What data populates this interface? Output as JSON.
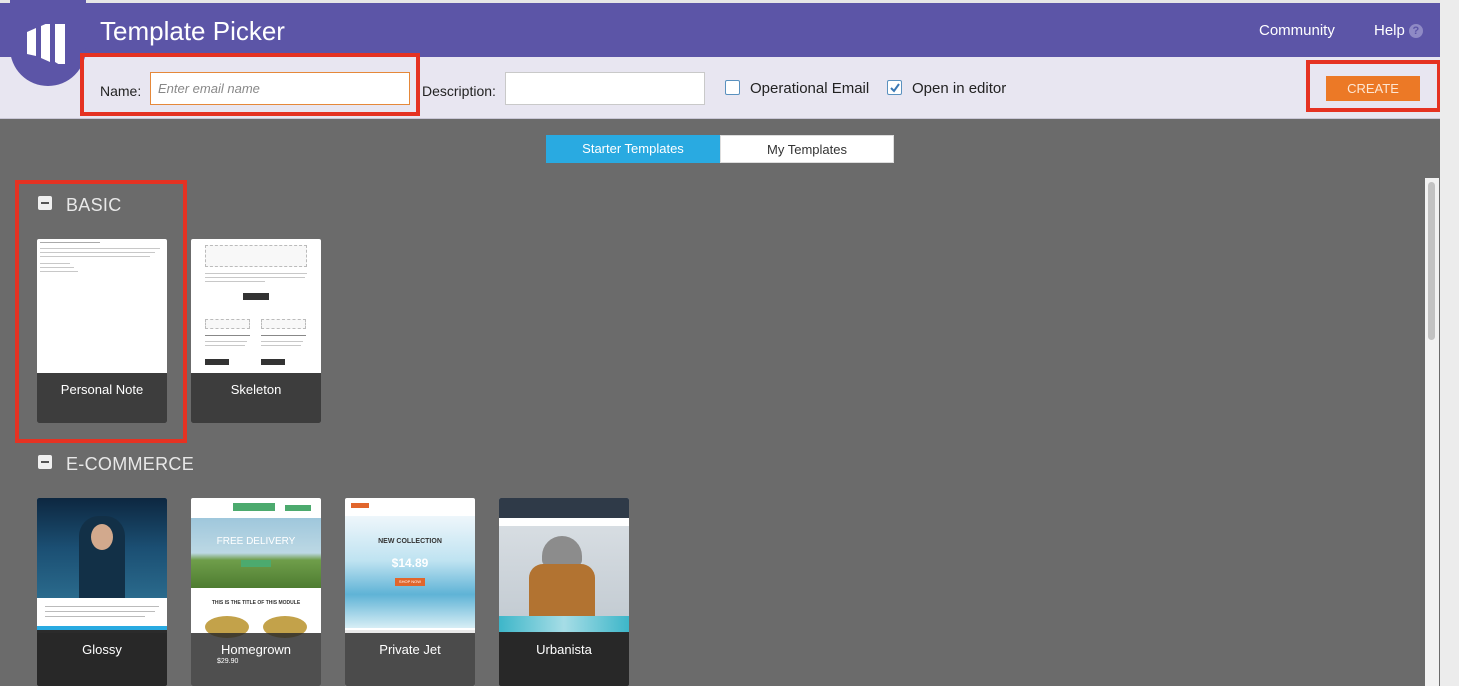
{
  "header": {
    "title": "Template Picker",
    "nav": {
      "community": "Community",
      "help": "Help"
    }
  },
  "toolbar": {
    "name_label": "Name:",
    "name_placeholder": "Enter email name",
    "name_value": "",
    "description_label": "Description:",
    "description_value": "",
    "operational_email_label": "Operational Email",
    "operational_email_checked": false,
    "open_in_editor_label": "Open in editor",
    "open_in_editor_checked": true,
    "create_label": "CREATE"
  },
  "tabs": [
    {
      "label": "Starter Templates",
      "active": true
    },
    {
      "label": "My Templates",
      "active": false
    }
  ],
  "sections": {
    "basic": {
      "title": "BASIC",
      "templates": [
        "Personal Note",
        "Skeleton"
      ]
    },
    "ecommerce": {
      "title": "E-COMMERCE",
      "templates": [
        "Glossy",
        "Homegrown",
        "Private Jet",
        "Urbanista"
      ]
    }
  },
  "thumb_text": {
    "homegrown_headline": "FREE DELIVERY",
    "homegrown_module": "THIS IS THE TITLE OF THIS MODULE",
    "homegrown_price": "$29.90",
    "privatejet_headline": "NEW COLLECTION",
    "privatejet_price": "$14.89",
    "privatejet_cta": "SHOP NOW"
  },
  "colors": {
    "header_bg": "#5c55a7",
    "toolbar_bg": "#e8e6f1",
    "workspace_bg": "#6b6b6b",
    "accent_blue": "#29aae1",
    "create_orange": "#ec7926",
    "highlight_red": "#e53222"
  },
  "icons": {
    "logo": "marketo-logo-icon",
    "help": "help-circle-icon",
    "collapse": "minus-square-icon",
    "check": "checkmark-icon"
  }
}
